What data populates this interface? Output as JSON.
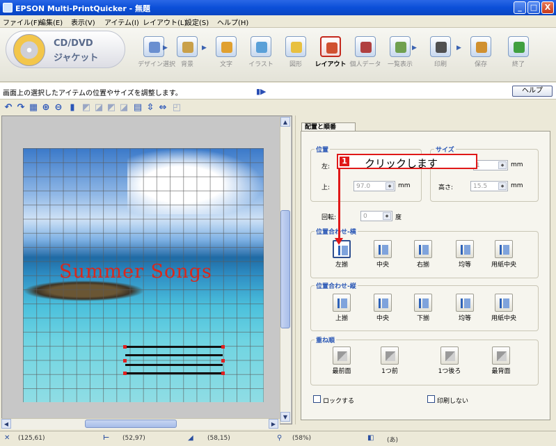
{
  "window": {
    "title": "EPSON Multi-PrintQuicker - 無題",
    "min": "_",
    "max": "□",
    "close": "X"
  },
  "menu": [
    "ファイル(F)",
    "編集(E)",
    "表示(V)",
    "アイテム(I)",
    "レイアウト(L)",
    "設定(S)",
    "ヘルプ(H)"
  ],
  "logo": {
    "line1": "CD/DVD",
    "line2": "ジャケット"
  },
  "steps": [
    {
      "label": "デザイン選択",
      "color": "#6a8fd0"
    },
    {
      "label": "背景",
      "color": "#c9a04a"
    },
    {
      "label": "文字",
      "color": "#e0a030"
    },
    {
      "label": "イラスト",
      "color": "#5aa0d8"
    },
    {
      "label": "図形",
      "color": "#e8c040"
    },
    {
      "label": "レイアウト",
      "color": "#d05030"
    },
    {
      "label": "個人データ",
      "color": "#b04040"
    },
    {
      "label": "一覧表示",
      "color": "#70a050"
    },
    {
      "label": "印刷",
      "color": "#505050"
    },
    {
      "label": "保存",
      "color": "#d09030"
    },
    {
      "label": "終了",
      "color": "#40a040"
    }
  ],
  "hint": {
    "text": "画面上の選択したアイテムの位置やサイズを調整します。",
    "help": "ヘルプ"
  },
  "artboard": {
    "title": "Summer Songs"
  },
  "panel": {
    "tab": "配置と順番",
    "position_group": "位置",
    "size_group": "サイズ",
    "left_label": "左:",
    "top_label": "上:",
    "top_value": "97.0",
    "width_value": "1",
    "height_label": "高さ:",
    "height_value": "15.5",
    "unit": "mm",
    "rotate_label": "回転:",
    "rotate_value": "0",
    "rotate_unit": "度",
    "h_align_group": "位置合わせ-横",
    "h_align": [
      "左揃",
      "中央",
      "右揃",
      "均等",
      "用紙中央"
    ],
    "v_align_group": "位置合わせ-縦",
    "v_align": [
      "上揃",
      "中央",
      "下揃",
      "均等",
      "用紙中央"
    ],
    "order_group": "重ね順",
    "order": [
      "最前面",
      "1つ前",
      "1つ後ろ",
      "最背面"
    ],
    "lock": "ロックする",
    "no_print": "印刷しない"
  },
  "callout": {
    "number": "1",
    "text": "クリックします"
  },
  "status": {
    "pos1": "(125,61)",
    "pos2": "(52,97)",
    "pos3": "(58,15)",
    "zoom": "(58%)",
    "extra": "(あ)"
  }
}
